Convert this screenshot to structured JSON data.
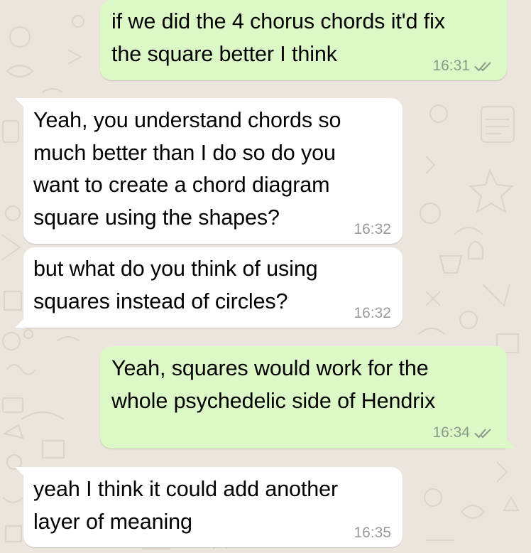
{
  "colors": {
    "outgoing_bubble": "#dcf8c6",
    "incoming_bubble": "#ffffff",
    "background": "#ece5dd",
    "timestamp_outgoing": "#8a9a8a",
    "timestamp_incoming": "#9a9a9a",
    "tick": "#8a9a8a"
  },
  "messages": [
    {
      "direction": "outgoing",
      "text": "if we did the 4 chorus chords it'd fix\nthe square better I think",
      "time": "16:31",
      "status_icon": "double-check-icon"
    },
    {
      "direction": "incoming",
      "text": "Yeah, you understand chords so\nmuch better than I do so do you\nwant to create a chord diagram\nsquare using the shapes?",
      "time": "16:32"
    },
    {
      "direction": "incoming",
      "text": "but what do you think of using\nsquares instead of circles?",
      "time": "16:32"
    },
    {
      "direction": "outgoing",
      "text": "Yeah, squares would work for the\nwhole psychedelic side of Hendrix",
      "time": "16:34",
      "status_icon": "double-check-icon"
    },
    {
      "direction": "incoming",
      "text": "yeah I think it could add another\nlayer of meaning",
      "time": "16:35"
    }
  ]
}
